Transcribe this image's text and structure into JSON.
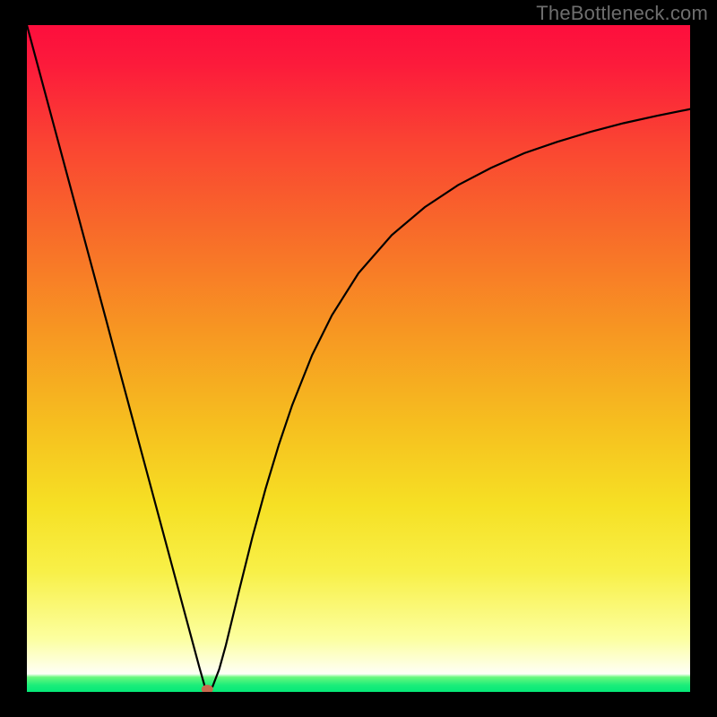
{
  "watermark": "TheBottleneck.com",
  "chart_data": {
    "type": "line",
    "title": "",
    "xlabel": "",
    "ylabel": "",
    "xlim": [
      0,
      100
    ],
    "ylim": [
      0,
      100
    ],
    "grid": false,
    "legend": false,
    "annotations": [],
    "series": [
      {
        "name": "curve",
        "x": [
          0,
          2,
          4,
          6,
          8,
          10,
          12,
          14,
          16,
          18,
          20,
          22,
          24,
          26,
          27,
          28,
          29,
          30,
          32,
          34,
          36,
          38,
          40,
          43,
          46,
          50,
          55,
          60,
          65,
          70,
          75,
          80,
          85,
          90,
          95,
          100
        ],
        "y": [
          100,
          92.6,
          85.2,
          77.8,
          70.4,
          63.0,
          55.6,
          48.1,
          40.7,
          33.3,
          25.9,
          18.5,
          11.1,
          3.7,
          0.2,
          0.8,
          3.4,
          7.0,
          15.2,
          23.2,
          30.5,
          37.1,
          43.0,
          50.5,
          56.5,
          62.8,
          68.5,
          72.7,
          76.0,
          78.6,
          80.8,
          82.5,
          84.0,
          85.3,
          86.4,
          87.4
        ]
      }
    ],
    "marker": {
      "x": 27.2,
      "y": 0.4,
      "color": "#c86a4e"
    }
  },
  "colors": {
    "curve": "#000000",
    "marker": "#c86a4e",
    "frame_bg": "#000000"
  }
}
